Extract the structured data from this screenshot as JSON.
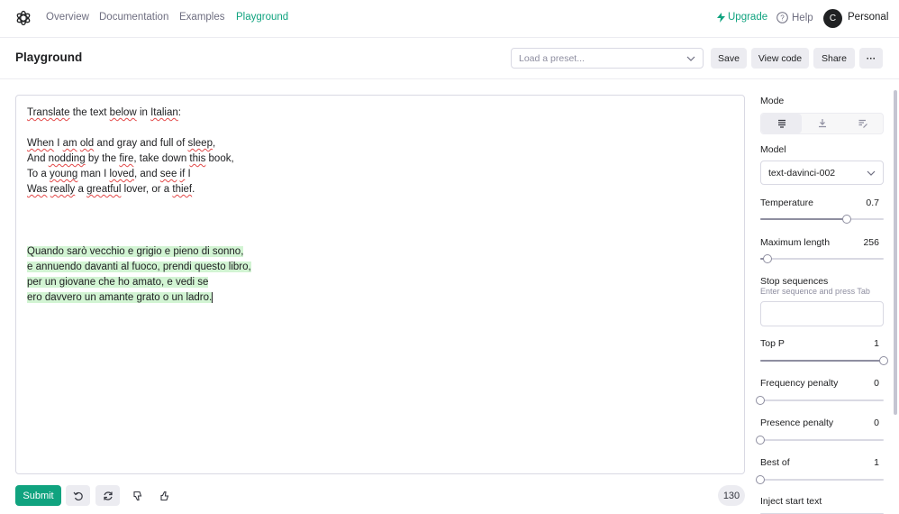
{
  "nav": {
    "links": [
      "Overview",
      "Documentation",
      "Examples",
      "Playground"
    ],
    "upgrade": "Upgrade",
    "help": "Help",
    "avatar_initial": "C",
    "account": "Personal"
  },
  "header": {
    "title": "Playground",
    "preset_placeholder": "Load a preset...",
    "save": "Save",
    "view_code": "View code",
    "share": "Share",
    "more": "···"
  },
  "editor": {
    "prompt_lines": [
      "Translate the text below in Italian:",
      "When I am old and gray and full of sleep,",
      "And nodding by the fire, take down this book,",
      "To a young man I loved, and see if I",
      "Was really a greatful lover, or a thief."
    ],
    "completion_lines": [
      "Quando sarò vecchio e grigio e pieno di sonno,",
      "e annuendo davanti al fuoco, prendi questo libro,",
      "per un giovane che ho amato, e vedi se",
      "ero davvero un amante grato o un ladro."
    ]
  },
  "toolbar": {
    "submit": "Submit",
    "token_count": "130"
  },
  "sidebar": {
    "mode_label": "Mode",
    "model_label": "Model",
    "model_value": "text-davinci-002",
    "temperature_label": "Temperature",
    "temperature_value": "0.7",
    "temperature_level": 0.7,
    "max_length_label": "Maximum length",
    "max_length_value": "256",
    "max_length_level": 0.06,
    "stop_label": "Stop sequences",
    "stop_hint": "Enter sequence and press Tab",
    "top_p_label": "Top P",
    "top_p_value": "1",
    "top_p_level": 1.0,
    "freq_label": "Frequency penalty",
    "freq_value": "0",
    "freq_level": 0.0,
    "presence_label": "Presence penalty",
    "presence_value": "0",
    "presence_level": 0.0,
    "best_of_label": "Best of",
    "best_of_value": "1",
    "best_of_level": 0.0,
    "inject_label": "Inject start text"
  },
  "colors": {
    "accent": "#10a37f",
    "highlight": "#d2f4d3"
  }
}
